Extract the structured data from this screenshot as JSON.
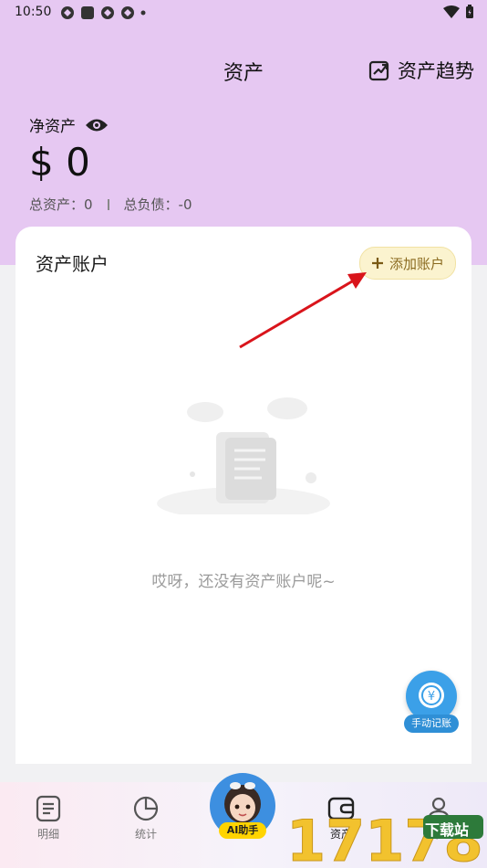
{
  "status_bar": {
    "time": "10:50"
  },
  "header": {
    "title": "资产",
    "trend_label": "资产趋势",
    "net_assets_label": "净资产",
    "net_assets_value": "$ 0",
    "total_assets": "总资产：0",
    "total_liabilities": "总负债：-0"
  },
  "card": {
    "title": "资产账户",
    "add_account_label": "添加账户",
    "empty_text": "哎呀，还没有资产账户呢~"
  },
  "fab": {
    "label": "手动记账",
    "symbol": "¥"
  },
  "tabbar": {
    "items": [
      {
        "label": "明细"
      },
      {
        "label": "统计"
      },
      {
        "label": "资产"
      },
      {
        "label": "我的"
      }
    ],
    "ai_label": "AI助手"
  },
  "watermark": {
    "text": "下载站",
    "number": "17178"
  },
  "colors": {
    "header_bg": "#e6c8f2",
    "accent_blue": "#3ba0e8",
    "add_button_bg": "#fbf3cf",
    "arrow": "#d9141b"
  }
}
